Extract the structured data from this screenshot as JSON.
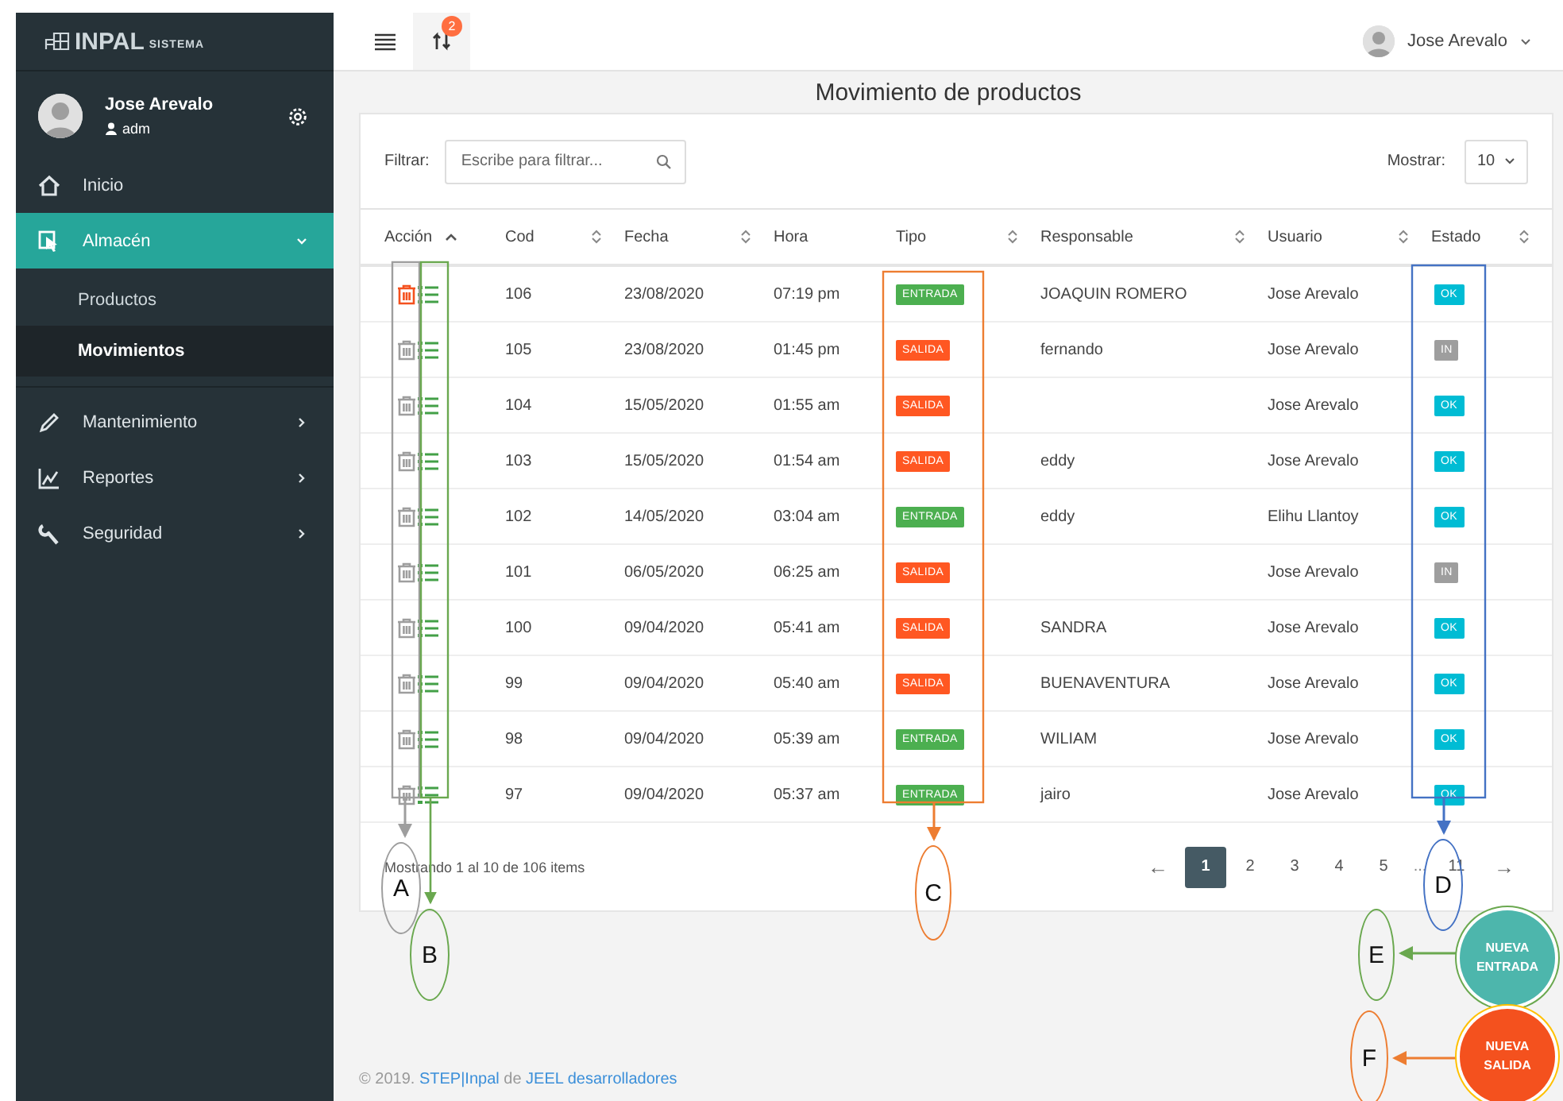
{
  "sidebar": {
    "logo": {
      "name": "INPAL",
      "suffix": "SISTEMA"
    },
    "user": {
      "name": "Jose Arevalo",
      "role": "adm"
    },
    "menu": [
      {
        "label": "Inicio",
        "selected": false
      },
      {
        "label": "Almacén",
        "selected": true,
        "expanded": true,
        "children": [
          {
            "label": "Productos",
            "selected": false
          },
          {
            "label": "Movimientos",
            "selected": true
          }
        ]
      },
      {
        "label": "Mantenimiento",
        "selected": false,
        "expanded": false
      },
      {
        "label": "Reportes",
        "selected": false,
        "expanded": false
      },
      {
        "label": "Seguridad",
        "selected": false,
        "expanded": false
      }
    ]
  },
  "topbar": {
    "notification_count": "2",
    "user": "Jose Arevalo"
  },
  "page_title": "Movimiento de productos",
  "filter": {
    "label": "Filtrar:",
    "placeholder": "Escribe para filtrar..."
  },
  "page_size": {
    "label": "Mostrar:",
    "value": "10"
  },
  "table": {
    "columns": [
      {
        "label": "Acción",
        "sortable": true,
        "sorted": true
      },
      {
        "label": "Cod",
        "sortable": true,
        "sorted": false
      },
      {
        "label": "Fecha",
        "sortable": true,
        "sorted": false
      },
      {
        "label": "Hora",
        "sortable": false
      },
      {
        "label": "Tipo",
        "sortable": true,
        "sorted": false
      },
      {
        "label": "Responsable",
        "sortable": true,
        "sorted": false
      },
      {
        "label": "Usuario",
        "sortable": true,
        "sorted": false
      },
      {
        "label": "Estado",
        "sortable": true,
        "sorted": false
      }
    ],
    "rows": [
      {
        "highlighted": true,
        "cod": "106",
        "fecha": "23/08/2020",
        "hora": "07:19 pm",
        "tipo": {
          "text": "ENTRADA",
          "color": "#4caf50"
        },
        "responsable": "JOAQUIN ROMERO",
        "usuario": "Jose Arevalo",
        "estado": {
          "text": "OK",
          "color": "#00bcd4"
        }
      },
      {
        "highlighted": false,
        "cod": "105",
        "fecha": "23/08/2020",
        "hora": "01:45 pm",
        "tipo": {
          "text": "SALIDA",
          "color": "#ff5722"
        },
        "responsable": "fernando",
        "usuario": "Jose Arevalo",
        "estado": {
          "text": "IN",
          "color": "#9e9e9e"
        }
      },
      {
        "highlighted": false,
        "cod": "104",
        "fecha": "15/05/2020",
        "hora": "01:55 am",
        "tipo": {
          "text": "SALIDA",
          "color": "#ff5722"
        },
        "usuario": "Jose Arevalo",
        "estado": {
          "text": "OK",
          "color": "#00bcd4"
        }
      },
      {
        "highlighted": false,
        "cod": "103",
        "fecha": "15/05/2020",
        "hora": "01:54 am",
        "tipo": {
          "text": "SALIDA",
          "color": "#ff5722"
        },
        "responsable": "eddy",
        "usuario": "Jose Arevalo",
        "estado": {
          "text": "OK",
          "color": "#00bcd4"
        }
      },
      {
        "highlighted": false,
        "cod": "102",
        "fecha": "14/05/2020",
        "hora": "03:04 am",
        "tipo": {
          "text": "ENTRADA",
          "color": "#4caf50"
        },
        "responsable": "eddy",
        "usuario": "Elihu Llantoy",
        "estado": {
          "text": "OK",
          "color": "#00bcd4"
        }
      },
      {
        "highlighted": false,
        "cod": "101",
        "fecha": "06/05/2020",
        "hora": "06:25 am",
        "tipo": {
          "text": "SALIDA",
          "color": "#ff5722"
        },
        "usuario": "Jose Arevalo",
        "estado": {
          "text": "IN",
          "color": "#9e9e9e"
        }
      },
      {
        "highlighted": false,
        "cod": "100",
        "fecha": "09/04/2020",
        "hora": "05:41 am",
        "tipo": {
          "text": "SALIDA",
          "color": "#ff5722"
        },
        "responsable": "SANDRA",
        "usuario": "Jose Arevalo",
        "estado": {
          "text": "OK",
          "color": "#00bcd4"
        }
      },
      {
        "highlighted": false,
        "cod": "99",
        "fecha": "09/04/2020",
        "hora": "05:40 am",
        "tipo": {
          "text": "SALIDA",
          "color": "#ff5722"
        },
        "responsable": "BUENAVENTURA",
        "usuario": "Jose Arevalo",
        "estado": {
          "text": "OK",
          "color": "#00bcd4"
        }
      },
      {
        "highlighted": false,
        "cod": "98",
        "fecha": "09/04/2020",
        "hora": "05:39 am",
        "tipo": {
          "text": "ENTRADA",
          "color": "#4caf50"
        },
        "responsable": "WILIAM",
        "usuario": "Jose Arevalo",
        "estado": {
          "text": "OK",
          "color": "#00bcd4"
        }
      },
      {
        "highlighted": false,
        "cod": "97",
        "fecha": "09/04/2020",
        "hora": "05:37 am",
        "tipo": {
          "text": "ENTRADA",
          "color": "#4caf50"
        },
        "responsable": "jairo",
        "usuario": "Jose Arevalo",
        "estado": {
          "text": "OK",
          "color": "#00bcd4"
        }
      }
    ]
  },
  "summary": "Mostrando 1 al 10 de 106 items",
  "pagination": [
    {
      "label": "←",
      "kind": "arrow",
      "selected": false
    },
    {
      "label": "1",
      "kind": "page",
      "selected": true
    },
    {
      "label": "2",
      "kind": "page",
      "selected": false
    },
    {
      "label": "3",
      "kind": "page",
      "selected": false
    },
    {
      "label": "4",
      "kind": "page",
      "selected": false
    },
    {
      "label": "5",
      "kind": "page",
      "selected": false
    },
    {
      "label": "...",
      "kind": "gap"
    },
    {
      "label": "11",
      "kind": "page",
      "selected": false
    },
    {
      "label": "→",
      "kind": "arrow",
      "selected": false
    }
  ],
  "fab_buttons": [
    {
      "label": "NUEVA ENTRADA",
      "color": "#4db6ac"
    },
    {
      "label": "NUEVA SALIDA",
      "color": "#f4511e"
    }
  ],
  "callouts": [
    {
      "letter": "A",
      "color": "#9e9e9e"
    },
    {
      "letter": "B",
      "color": "#6aa84f"
    },
    {
      "letter": "C",
      "color": "#ed7d31"
    },
    {
      "letter": "D",
      "color": "#4472c4"
    },
    {
      "letter": "E",
      "color": "#6aa84f"
    },
    {
      "letter": "F",
      "color": "#ed7d31"
    }
  ],
  "footer": {
    "copyright": "© 2019.",
    "brand": "STEP|Inpal",
    "joiner": "de",
    "company": "JEEL desarrolladores"
  }
}
